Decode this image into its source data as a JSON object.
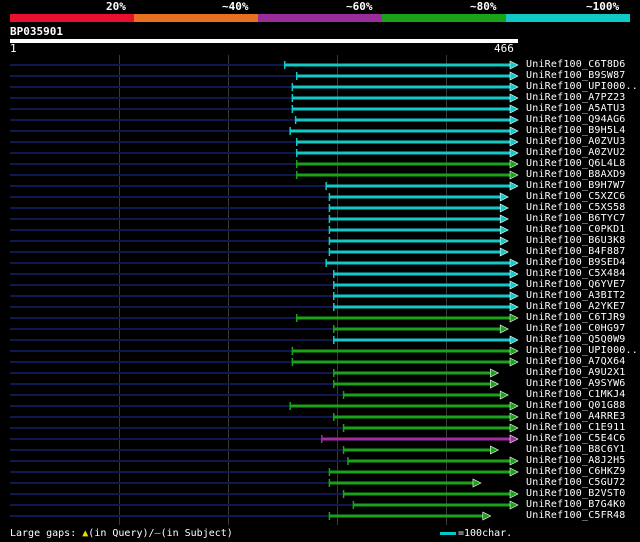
{
  "legend": {
    "labels": [
      "20%",
      "~40%",
      "~60%",
      "~80%",
      "~100%"
    ],
    "colors": [
      "#e8112d",
      "#e87020",
      "#9b2c9b",
      "#1aa21a",
      "#10c8c8"
    ]
  },
  "query": {
    "id": "BP035901",
    "length_label": "466",
    "start_label": "1",
    "length": 466
  },
  "colors": {
    "cyan": "#14c8c8",
    "green": "#1aa21a",
    "magenta": "#a22ca2",
    "dim_line": "#101850"
  },
  "hits": [
    {
      "name": "UniRef100_C6T8D6",
      "start": 252,
      "end": 466,
      "color": "cyan"
    },
    {
      "name": "UniRef100_B9SW87",
      "start": 263,
      "end": 466,
      "color": "cyan"
    },
    {
      "name": "UniRef100_UPI000..",
      "start": 259,
      "end": 466,
      "color": "cyan"
    },
    {
      "name": "UniRef100_A7PZ23",
      "start": 259,
      "end": 466,
      "color": "cyan"
    },
    {
      "name": "UniRef100_A5ATU3",
      "start": 259,
      "end": 466,
      "color": "cyan"
    },
    {
      "name": "UniRef100_Q94AG6",
      "start": 262,
      "end": 466,
      "color": "cyan"
    },
    {
      "name": "UniRef100_B9H5L4",
      "start": 257,
      "end": 466,
      "color": "cyan"
    },
    {
      "name": "UniRef100_A0ZVU3",
      "start": 263,
      "end": 466,
      "color": "cyan"
    },
    {
      "name": "UniRef100_A0ZVU2",
      "start": 263,
      "end": 466,
      "color": "cyan"
    },
    {
      "name": "UniRef100_Q6L4L8",
      "start": 263,
      "end": 466,
      "color": "green"
    },
    {
      "name": "UniRef100_B8AXD9",
      "start": 263,
      "end": 466,
      "color": "green"
    },
    {
      "name": "UniRef100_B9H7W7",
      "start": 290,
      "end": 466,
      "color": "cyan"
    },
    {
      "name": "UniRef100_C5XZC6",
      "start": 293,
      "end": 457,
      "color": "cyan"
    },
    {
      "name": "UniRef100_C5XS58",
      "start": 293,
      "end": 457,
      "color": "cyan"
    },
    {
      "name": "UniRef100_B6TYC7",
      "start": 293,
      "end": 457,
      "color": "cyan"
    },
    {
      "name": "UniRef100_C0PKD1",
      "start": 293,
      "end": 457,
      "color": "cyan"
    },
    {
      "name": "UniRef100_B6U3K8",
      "start": 293,
      "end": 457,
      "color": "cyan"
    },
    {
      "name": "UniRef100_B4F887",
      "start": 293,
      "end": 457,
      "color": "cyan"
    },
    {
      "name": "UniRef100_B9SED4",
      "start": 290,
      "end": 466,
      "color": "cyan"
    },
    {
      "name": "UniRef100_C5X484",
      "start": 297,
      "end": 466,
      "color": "cyan"
    },
    {
      "name": "UniRef100_Q6YVE7",
      "start": 297,
      "end": 466,
      "color": "cyan"
    },
    {
      "name": "UniRef100_A3BIT2",
      "start": 297,
      "end": 466,
      "color": "cyan"
    },
    {
      "name": "UniRef100_A2YKE7",
      "start": 297,
      "end": 466,
      "color": "cyan"
    },
    {
      "name": "UniRef100_C6TJR9",
      "start": 263,
      "end": 466,
      "color": "green"
    },
    {
      "name": "UniRef100_C0HG97",
      "start": 297,
      "end": 457,
      "color": "green"
    },
    {
      "name": "UniRef100_Q5Q0W9",
      "start": 297,
      "end": 466,
      "color": "cyan"
    },
    {
      "name": "UniRef100_UPI000..",
      "start": 259,
      "end": 466,
      "color": "green"
    },
    {
      "name": "UniRef100_A7QX64",
      "start": 259,
      "end": 466,
      "color": "green"
    },
    {
      "name": "UniRef100_A9U2X1",
      "start": 297,
      "end": 448,
      "color": "green"
    },
    {
      "name": "UniRef100_A9SYW6",
      "start": 297,
      "end": 448,
      "color": "green"
    },
    {
      "name": "UniRef100_C1MKJ4",
      "start": 306,
      "end": 457,
      "color": "green"
    },
    {
      "name": "UniRef100_Q01G88",
      "start": 257,
      "end": 466,
      "color": "green"
    },
    {
      "name": "UniRef100_A4RRE3",
      "start": 297,
      "end": 466,
      "color": "green"
    },
    {
      "name": "UniRef100_C1E911",
      "start": 306,
      "end": 466,
      "color": "green"
    },
    {
      "name": "UniRef100_C5E4C6",
      "start": 286,
      "end": 466,
      "color": "magenta"
    },
    {
      "name": "UniRef100_B8C6Y1",
      "start": 306,
      "end": 448,
      "color": "green"
    },
    {
      "name": "UniRef100_A8J2H5",
      "start": 310,
      "end": 466,
      "color": "green"
    },
    {
      "name": "UniRef100_C6HKZ9",
      "start": 293,
      "end": 466,
      "color": "green"
    },
    {
      "name": "UniRef100_C5GU72",
      "start": 293,
      "end": 432,
      "color": "green"
    },
    {
      "name": "UniRef100_B2VST0",
      "start": 306,
      "end": 466,
      "color": "green"
    },
    {
      "name": "UniRef100_B7G4K0",
      "start": 315,
      "end": 466,
      "color": "green"
    },
    {
      "name": "UniRef100_C5FR48",
      "start": 293,
      "end": 441,
      "color": "green"
    }
  ],
  "footer": {
    "large_gaps_label": "Large gaps:",
    "query_gap_symbol": "▲",
    "query_gap_text": "(in Query)/",
    "subject_gap_symbol": "—",
    "subject_gap_text": "(in Subject)",
    "scale_text": "=100char."
  }
}
